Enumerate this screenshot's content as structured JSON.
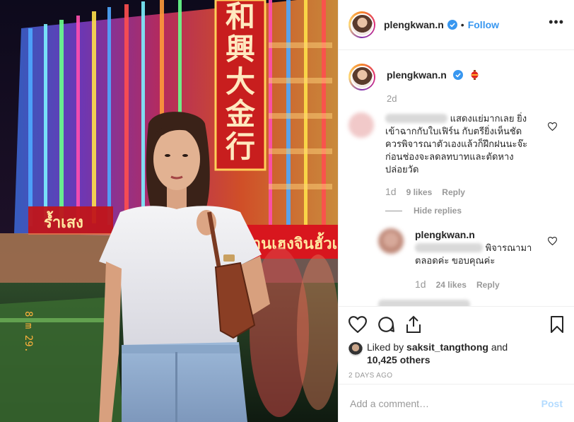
{
  "header": {
    "username": "plengkwan.n",
    "separator": "•",
    "follow_label": "Follow",
    "more_label": "•••"
  },
  "caption": {
    "username": "plengkwan.n",
    "time": "2d"
  },
  "comments": [
    {
      "text": "แสดงแย่มากเลย ยิ่งเข้าฉากกับใบเฟิร์น กับตรียิ่งเห็นชัด ควรพิจารณาตัวเองแล้วก็ฝึกฝนนะจ๊ะก่อนช่องจะลดลทบาทและตัดหาง ปล่อยวัด",
      "time": "1d",
      "likes": "9 likes",
      "reply_label": "Reply",
      "hide_replies_label": "Hide replies"
    },
    {
      "username": "plengkwan.n",
      "text": "พิจารณามาตลอดค่ะ ขอบคุณค่ะ",
      "time": "1d",
      "likes": "24 likes",
      "reply_label": "Reply"
    }
  ],
  "likes": {
    "liked_by_prefix": "Liked by",
    "liked_by_user": "saksit_tangthong",
    "and": "and",
    "others": "10,425 others"
  },
  "timestamp": "2 DAYS AGO",
  "add_comment": {
    "placeholder": "Add a comment…",
    "post_label": "Post"
  },
  "photo": {
    "sign_chars": [
      "和",
      "興",
      "大",
      "金",
      "行"
    ],
    "shop_sign": "ร้านเฮงจินฮั้วเฮง",
    "left_sign": "ร้ำเสง",
    "date_stamp": "8 m 29."
  },
  "colors": {
    "accent": "#3897f0",
    "muted": "#999999",
    "text": "#262626",
    "verified": "#3897f0",
    "post_disabled": "#b3dbff"
  }
}
